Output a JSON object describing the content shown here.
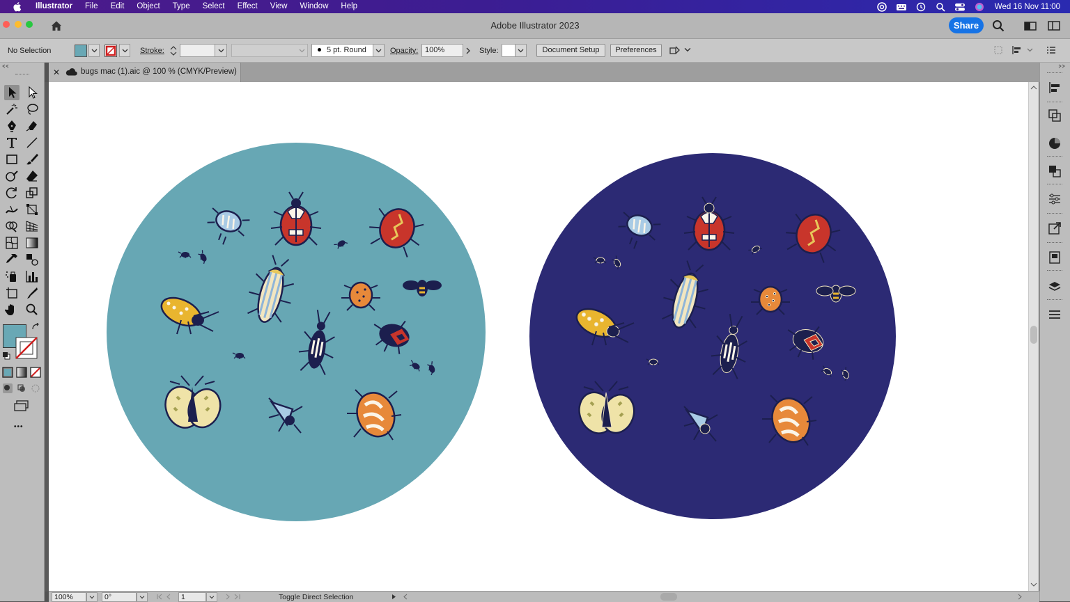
{
  "menubar": {
    "app_name": "Illustrator",
    "items": [
      "File",
      "Edit",
      "Object",
      "Type",
      "Select",
      "Effect",
      "View",
      "Window",
      "Help"
    ],
    "clock": "Wed 16 Nov  11:00"
  },
  "titlebar": {
    "title": "Adobe Illustrator 2023",
    "share_label": "Share"
  },
  "control_bar": {
    "selection_status": "No Selection",
    "fill_color": "#69a8b5",
    "stroke_label": "Stroke:",
    "brush_value": "5 pt. Round",
    "opacity_label": "Opacity:",
    "opacity_value": "100%",
    "style_label": "Style:",
    "document_setup_label": "Document Setup",
    "preferences_label": "Preferences"
  },
  "document_tab": {
    "title": "bugs mac (1).aic @ 100 % (CMYK/Preview)",
    "close_glyph": "✕"
  },
  "toolbar": {
    "fill_color": "#69a8b5",
    "more_glyph": "•••"
  },
  "artboard": {
    "left_circle_color": "#67a7b4",
    "right_circle_color": "#2c2a74"
  },
  "status_bar": {
    "zoom": "100%",
    "rotation": "0°",
    "artboard_number": "1",
    "current_tool": "Toggle Direct Selection"
  }
}
